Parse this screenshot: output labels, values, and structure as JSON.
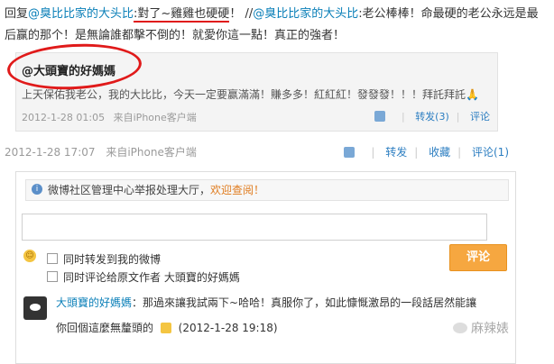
{
  "repost": {
    "prefix": "回复",
    "mention1": "@臭比比家的大头比",
    "highlight": ":對了~雞雞也硬硬",
    "rest1": "！ //",
    "mention2": "@臭比比家的大头比",
    "rest2": ":老公棒棒！命最硬的老公永远是最后赢的那个！是無論誰都擊不倒的！就愛你這一點！真正的強者！"
  },
  "original": {
    "author": "@大頭寶的好媽媽",
    "text": "上天保佑我老公，我的大比比，今天一定要赢滿滿！賺多多！紅紅紅！發發發！！！拜託拜託🙏",
    "time": "2012-1-28 01:05",
    "source": "来自iPhone客户端",
    "repost_label": "转发(3)",
    "comment_label": "评论"
  },
  "meta": {
    "time": "2012-1-28 17:07",
    "source": "来自iPhone客户端"
  },
  "actions": {
    "repost": "转发",
    "favorite": "收藏",
    "comment": "评论(1)"
  },
  "comment_box": {
    "notice_text": "微博社区管理中心举报处理大厅，",
    "notice_link": "欢迎查阅！",
    "input_value": "",
    "check1": "同时转发到我的微博",
    "check2": "同时评论给原文作者 大頭寶的好媽媽",
    "submit": "评论"
  },
  "comment": {
    "author": "大頭寶的好媽媽",
    "line1": "：那過來讓我試兩下~哈哈！真服你了，如此慷慨激昂的一段話居然能讓",
    "line2": "你回個這麼無釐頭的",
    "time": "(2012-1-28 19:18)"
  },
  "watermark": "麻辣婊",
  "colors": {
    "link": "#0a7fb8",
    "highlight_red": "#e01a1a",
    "button_orange": "#f6a740"
  }
}
